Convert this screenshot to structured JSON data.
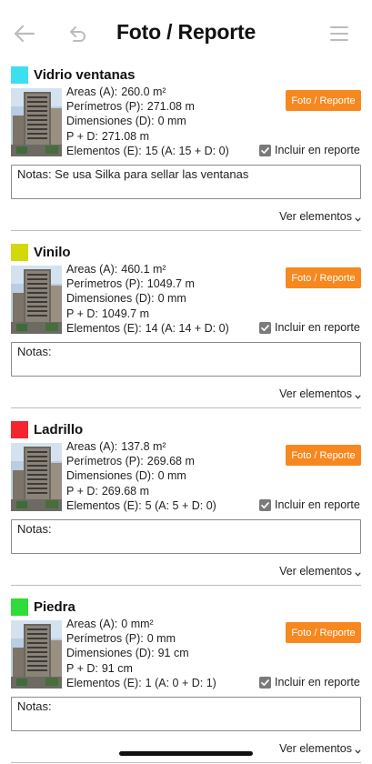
{
  "header": {
    "title": "Foto / Reporte",
    "icons": {
      "back": "back-arrow-icon",
      "undo": "undo-icon",
      "menu": "hamburger-menu-icon"
    }
  },
  "labels": {
    "areas": "Areas (A):",
    "perimetros": "Perímetros (P):",
    "dimensiones": "Dimensiones (D):",
    "pd": "P + D:",
    "elementos": "Elementos (E):",
    "photo_button": "Foto / Reporte",
    "incluir": "Incluir en reporte",
    "ver_elementos": "Ver elementos"
  },
  "colors": {
    "accent_orange": "#f7881f",
    "checkbox_gray": "#7a7a7a"
  },
  "materials": [
    {
      "name": "Vidrio ventanas",
      "color": "#3cdff0",
      "areas": "260.0 m²",
      "perimetros": "271.08 m",
      "dimensiones": "0 mm",
      "pd": "271.08 m",
      "elementos": "15 (A: 15 + D: 0)",
      "incluir": true,
      "notes": "Notas: Se usa Silka para sellar las ventanas"
    },
    {
      "name": "Vinilo",
      "color": "#d2d90a",
      "areas": "460.1 m²",
      "perimetros": "1049.7 m",
      "dimensiones": "0 mm",
      "pd": "1049.7 m",
      "elementos": "14 (A: 14 + D: 0)",
      "incluir": true,
      "notes": "Notas:"
    },
    {
      "name": "Ladrillo",
      "color": "#f5252f",
      "areas": "137.8 m²",
      "perimetros": "269.68 m",
      "dimensiones": "0 mm",
      "pd": "269.68 m",
      "elementos": "5 (A: 5 + D: 0)",
      "incluir": true,
      "notes": "Notas:"
    },
    {
      "name": "Piedra",
      "color": "#2fdc3a",
      "areas": "0 mm²",
      "perimetros": "0 mm",
      "dimensiones": "91 cm",
      "pd": "91 cm",
      "elementos": "1 (A: 0 + D: 1)",
      "incluir": true,
      "notes": "Notas:"
    }
  ]
}
